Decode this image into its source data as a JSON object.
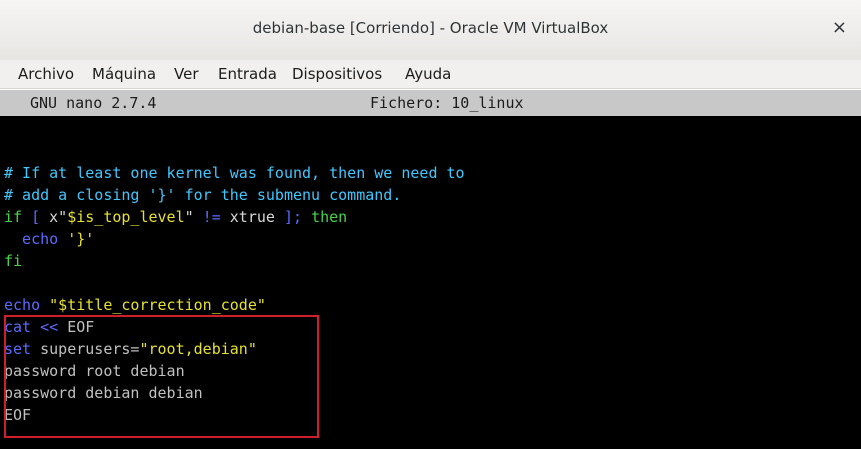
{
  "window": {
    "title": "debian-base [Corriendo] - Oracle VM VirtualBox",
    "close_glyph": "×"
  },
  "menubar": {
    "items": [
      "Archivo",
      "Máquina",
      "Ver",
      "Entrada",
      "Dispositivos",
      "Ayuda"
    ]
  },
  "nano": {
    "version": "GNU nano 2.7.4",
    "file": "Fichero: 10_linux"
  },
  "editor": {
    "lines": [
      {
        "segments": [
          {
            "text": "# If at least one kernel was found, then we need to",
            "color": "cyan"
          }
        ]
      },
      {
        "segments": [
          {
            "text": "# add a closing '}' for the submenu command.",
            "color": "cyan"
          }
        ]
      },
      {
        "segments": [
          {
            "text": "if",
            "color": "green"
          },
          {
            "text": " [ ",
            "color": "blue"
          },
          {
            "text": "x\"",
            "color": "white"
          },
          {
            "text": "$is_top_level",
            "color": "yellow"
          },
          {
            "text": "\"",
            "color": "white"
          },
          {
            "text": " != ",
            "color": "blue"
          },
          {
            "text": "xtrue",
            "color": "white"
          },
          {
            "text": " ]; ",
            "color": "blue"
          },
          {
            "text": "then",
            "color": "green"
          }
        ]
      },
      {
        "segments": [
          {
            "text": "  echo ",
            "color": "blue"
          },
          {
            "text": "'}'",
            "color": "yellow"
          }
        ]
      },
      {
        "segments": [
          {
            "text": "fi",
            "color": "green"
          }
        ]
      },
      {
        "segments": [
          {
            "text": "",
            "color": "gray"
          }
        ]
      },
      {
        "segments": [
          {
            "text": "echo ",
            "color": "blue"
          },
          {
            "text": "\"$title_correction_code\"",
            "color": "yellow"
          }
        ]
      },
      {
        "segments": [
          {
            "text": "cat",
            "color": "blue"
          },
          {
            "text": " << ",
            "color": "blue"
          },
          {
            "text": "EOF",
            "color": "gray"
          }
        ]
      },
      {
        "segments": [
          {
            "text": "set",
            "color": "blue"
          },
          {
            "text": " superusers=",
            "color": "gray"
          },
          {
            "text": "\"root,debian\"",
            "color": "yellow"
          }
        ]
      },
      {
        "segments": [
          {
            "text": "password root debian",
            "color": "gray"
          }
        ]
      },
      {
        "segments": [
          {
            "text": "password debian debian",
            "color": "gray"
          }
        ]
      },
      {
        "segments": [
          {
            "text": "EOF",
            "color": "gray"
          }
        ]
      }
    ]
  },
  "colors": {
    "highlight_border": "#d01f2b",
    "terminal_bg": "#000000"
  }
}
